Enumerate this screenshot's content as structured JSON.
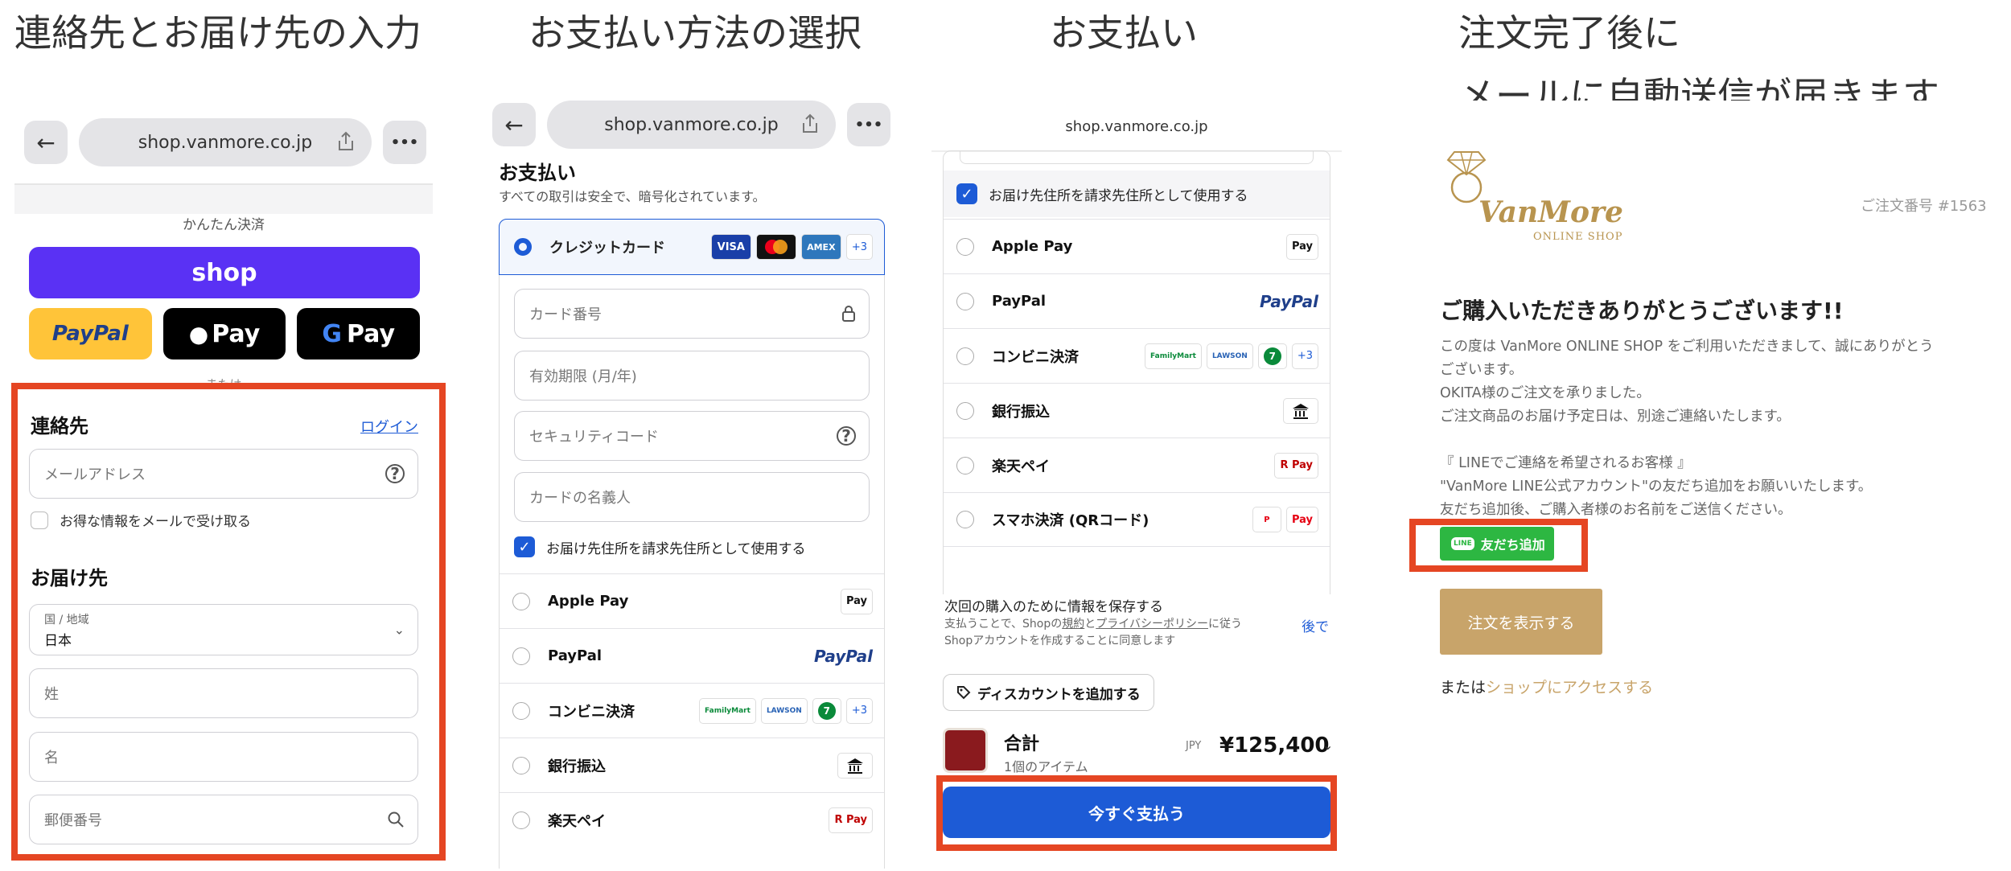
{
  "titles": {
    "step1": "連絡先とお届け先の入力",
    "step2": "お支払い方法の選択",
    "step3": "お支払い",
    "step4_line1": "注文完了後に",
    "step4_line2": "メールに自動送信が届きます"
  },
  "browser": {
    "url": "shop.vanmore.co.jp",
    "back_glyph": "←",
    "menu_glyph": "•••"
  },
  "panel1": {
    "express_label": "かんたん決済",
    "shop_button": "shop",
    "paypal_button": "PayPal",
    "applepay_button": "Pay",
    "gpay_button": "Pay",
    "or_label": "または",
    "contact_heading": "連絡先",
    "login_link": "ログイン",
    "email_placeholder": "メールアドレス",
    "newsletter_label": "お得な情報をメールで受け取る",
    "delivery_heading": "お届け先",
    "country_label": "国 / 地域",
    "country_value": "日本",
    "lastname_placeholder": "姓",
    "firstname_placeholder": "名",
    "postal_placeholder": "郵便番号"
  },
  "panel2": {
    "heading": "お支払い",
    "secure_note": "すべての取引は安全で、暗号化されています。",
    "credit_card_label": "クレジットカード",
    "card_more": "+3",
    "card_brands": [
      "VISA",
      "AMEX"
    ],
    "card_number": "カード番号",
    "expiry": "有効期限 (月/年)",
    "security_code": "セキュリティコード",
    "card_name": "カードの名義人",
    "billing_same": "お届け先住所を請求先住所として使用する",
    "methods": [
      "Apple Pay",
      "PayPal",
      "コンビニ決済",
      "銀行振込",
      "楽天ペイ"
    ],
    "konbini_badges": [
      "FamilyMart",
      "LAWSON",
      "+3"
    ],
    "applepay_badge": "Pay",
    "paypal_badge": "PayPal",
    "rakuten_badge": "R Pay"
  },
  "panel3": {
    "url_plain": "shop.vanmore.co.jp",
    "billing_same": "お届け先住所を請求先住所として使用する",
    "methods": [
      "Apple Pay",
      "PayPal",
      "コンビニ決済",
      "銀行振込",
      "楽天ペイ",
      "スマホ決済 (QRコード)"
    ],
    "konbini_badges": [
      "FamilyMart",
      "LAWSON",
      "+3"
    ],
    "applepay_badge": "Pay",
    "paypal_badge": "PayPal",
    "rakuten_badge": "R Pay",
    "qr_badge": "Pay",
    "save_title": "次回の購入のために情報を保存する",
    "save_note_1": "支払うことで、Shopの",
    "terms": "規約",
    "and": "と",
    "privacy": "プライバシーポリシー",
    "save_note_2": "に従う",
    "save_note_3": "Shopアカウントを作成することに同意します",
    "later": "後で",
    "discount": "ディスカウントを追加する",
    "total_label": "合計",
    "items_count": "1個のアイテム",
    "currency": "JPY",
    "total_amount": "¥125,400",
    "pay_button": "今すぐ支払う"
  },
  "panel4": {
    "logo_main": "VanMore",
    "logo_sub": "ONLINE SHOP",
    "order_number": "ご注文番号 #1563",
    "thanks_heading": "ご購入いただきありがとうございます!!",
    "body_1": "この度は VanMore ONLINE SHOP をご利用いただきまして、誠にありがとう",
    "body_2": "ございます。",
    "body_3": "OKITA様のご注文を承りました。",
    "body_4": "ご注文商品のお届け予定日は、別途ご連絡いたします。",
    "line_1": "『 LINEでご連絡を希望されるお客様 』",
    "line_2": "\"VanMore LINE公式アカウント\"の友だち追加をお願いいたします。",
    "line_3": "友だち追加後、ご購入者様のお名前をご送信ください。",
    "line_badge": "LINE",
    "line_button": "友だち追加",
    "view_order": "注文を表示する",
    "or_text": "または",
    "shop_link": "ショップにアクセスする"
  },
  "colors": {
    "shop_purple": "#5a31f4",
    "paypal_yellow": "#ffc439",
    "highlight_red": "#e54623",
    "primary_blue": "#1d5bd6",
    "line_green": "#2db742",
    "gold": "#c8a46a"
  }
}
